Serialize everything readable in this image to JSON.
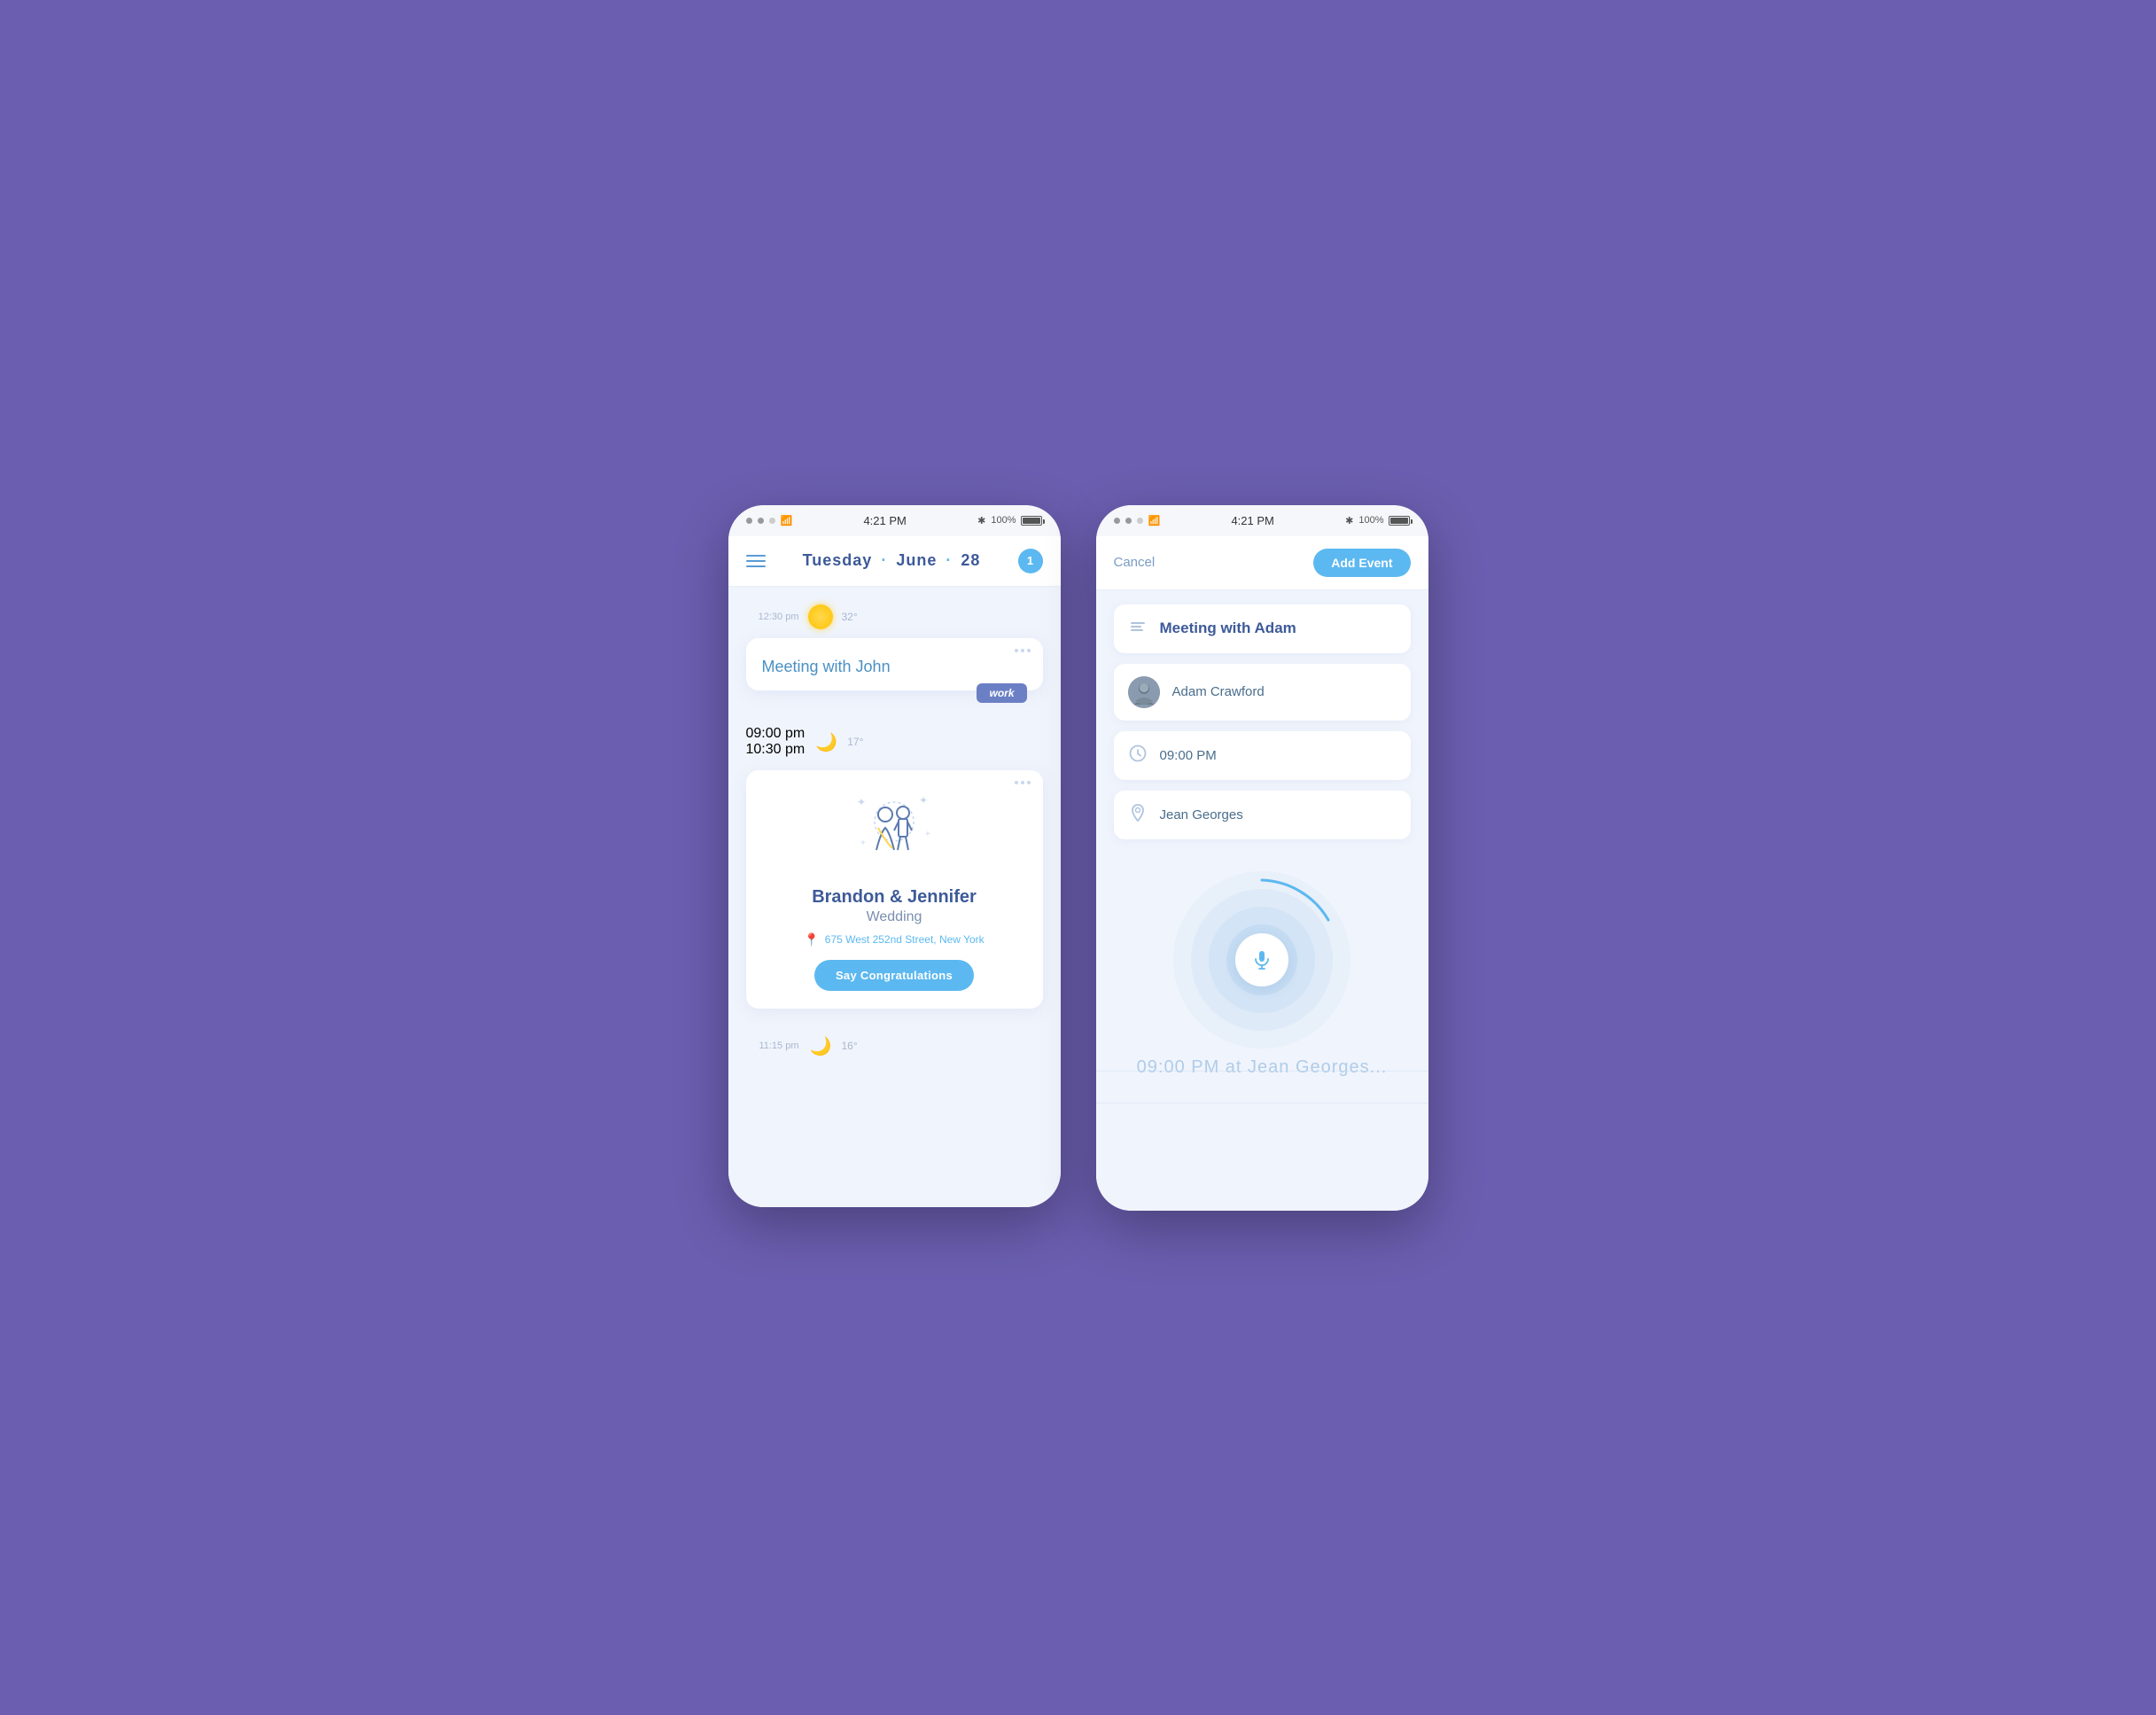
{
  "background_color": "#6b5eb0",
  "phones": {
    "left": {
      "status_bar": {
        "time": "4:21 PM",
        "battery": "100%",
        "signal": "●●○○"
      },
      "header": {
        "title": "Tuesday",
        "separator": "·",
        "day_month": "June · 28",
        "notification_count": "1"
      },
      "timeline": [
        {
          "time": "12:30 pm",
          "weather": "sun",
          "temp": "32°",
          "event_title": "Meeting with John",
          "event_tag": "work"
        },
        {
          "time_start": "09:00 pm",
          "time_end": "10:30 pm",
          "weather": "moon",
          "temp": "17°",
          "event_type": "wedding",
          "names": "Brandon & Jennifer",
          "subtitle": "Wedding",
          "location": "675 West 252nd Street, New York",
          "cta_label": "Say Congratulations"
        }
      ],
      "bottom_time": {
        "time": "11:15 pm",
        "weather": "moon",
        "temp": "16°"
      }
    },
    "right": {
      "status_bar": {
        "time": "4:21 PM",
        "battery": "100%"
      },
      "header": {
        "cancel_label": "Cancel",
        "add_event_label": "Add Event"
      },
      "form": {
        "event_title": "Meeting with Adam",
        "contact_name": "Adam Crawford",
        "time": "09:00 PM",
        "location": "Jean Georges"
      },
      "voice_text": "09:00 PM at Jean Georges...",
      "voice_label": "microphone"
    }
  }
}
